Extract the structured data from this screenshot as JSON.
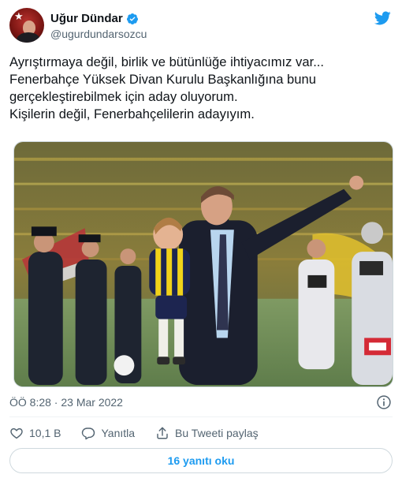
{
  "author": {
    "display_name": "Uğur Dündar",
    "handle": "@ugurdundarsozcu",
    "verified": true
  },
  "tweet": {
    "lines": [
      "Ayrıştırmaya değil, birlik ve bütünlüğe ihtiyacımız var...",
      "Fenerbahçe Yüksek Divan Kurulu Başkanlığına bunu",
      "gerçekleştirebilmek için aday oluyorum.",
      "Kişilerin değil, Fenerbahçelilerin adayıyım."
    ]
  },
  "meta": {
    "timestamp": "ÖÖ 8:28 · 23 Mar 2022"
  },
  "actions": {
    "like_count": "10,1 B",
    "reply_label": "Yanıtla",
    "share_label": "Bu Tweeti paylaş"
  },
  "footer": {
    "read_replies_label": "16 yanıtı oku"
  },
  "colors": {
    "accent": "#1d9bf0",
    "secondary_text": "#536471",
    "primary_text": "#0f1419",
    "border": "#cfd9de"
  },
  "icons": {
    "verified": "verified-badge-icon",
    "brand": "twitter-bird-icon",
    "info": "info-icon",
    "like": "heart-icon",
    "reply": "speech-bubble-icon",
    "share": "share-upload-icon"
  }
}
